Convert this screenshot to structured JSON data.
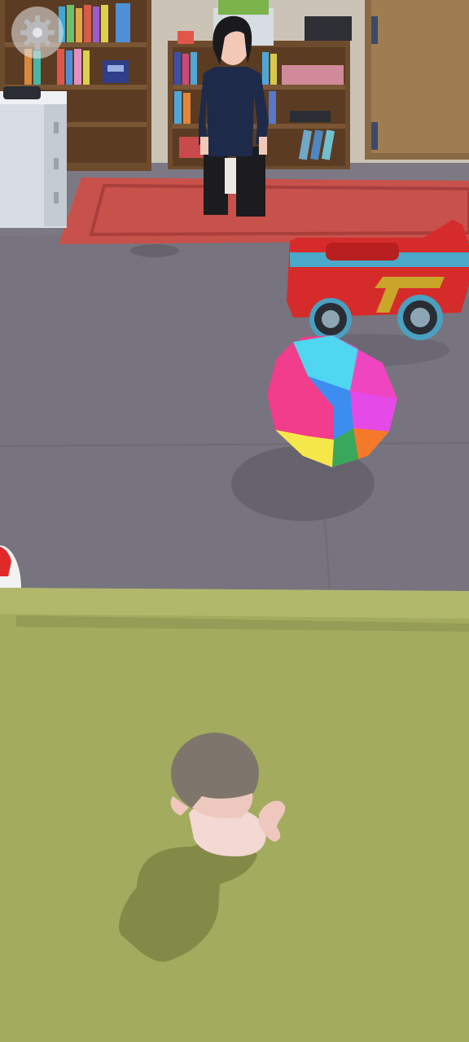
{
  "game": {
    "hud": {
      "settings_icon": "gear-icon"
    },
    "scene": {
      "characters": [
        "mother",
        "baby"
      ],
      "objects": [
        "bookshelf-left",
        "bookshelf-center",
        "dresser",
        "rug",
        "toy-car",
        "beach-ball",
        "red-ball",
        "play-mat",
        "door"
      ]
    },
    "colors": {
      "wall": "#c9c2b4",
      "floor": "#77747f",
      "rug": "#c8514c",
      "play_mat": "#a2ab5e",
      "toy_car": "#d62b2b",
      "ball_pink": "#f23c8c",
      "ball_cyan": "#4fd6f0",
      "ball_blue": "#3b8ef0",
      "ball_magenta": "#e54ae8",
      "ball_orange": "#f47a2a",
      "ball_green": "#3aa85a",
      "ball_yellow": "#f6e84a"
    }
  }
}
